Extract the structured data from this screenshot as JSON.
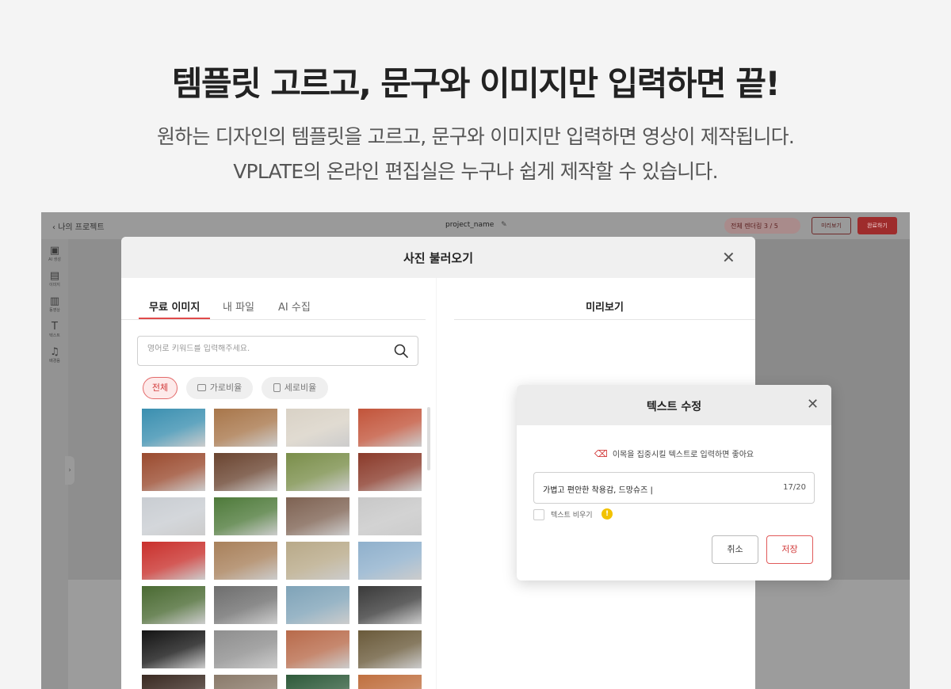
{
  "hero": {
    "title": "템플릿 고르고, 문구와 이미지만 입력하면 끝!",
    "subtitle_line1": "원하는 디자인의 템플릿을 고르고, 문구와 이미지만 입력하면 영상이 제작됩니다.",
    "subtitle_line2": "VPLATE의 온라인 편집실은 누구나 쉽게 제작할 수 있습니다."
  },
  "editor": {
    "back_label": "나의 프로젝트",
    "project_name": "project_name",
    "render_status": "전체 렌더링 3 / 5",
    "preview_button": "미리보기",
    "done_button": "완료하기",
    "rail": [
      "AI 생성",
      "이미지",
      "동영상",
      "텍스트",
      "배경음"
    ]
  },
  "photo_modal": {
    "title": "사진 불러오기",
    "tabs": [
      "무료 이미지",
      "내 파일",
      "AI 수집"
    ],
    "search_placeholder": "영어로 키워드를 입력해주세요.",
    "filters": [
      "전체",
      "가로비율",
      "세로비율"
    ],
    "preview_title": "미리보기",
    "thumbnail_colors": [
      [
        "#3a8fb0",
        "#a8764a",
        "#d9d2c6",
        "#c2543a"
      ],
      [
        "#9a4a2e",
        "#6a4430",
        "#7a8e4a",
        "#8a3a2a"
      ],
      [
        "#c9cdd2",
        "#4e7a3a",
        "#7e6252",
        "#c8c8c8"
      ],
      [
        "#c9302c",
        "#a8805a",
        "#b8a988",
        "#8fb0cc"
      ],
      [
        "#4a6a32",
        "#6e6e6e",
        "#7fa3b8",
        "#3a3a3a"
      ],
      [
        "#141414",
        "#8e8e8e",
        "#b86a4a",
        "#6a5a3a"
      ],
      [
        "#3a2a22",
        "#8a7a6a",
        "#2e5a3a",
        "#c07040"
      ]
    ]
  },
  "text_dialog": {
    "title": "텍스트 수정",
    "hint": "이목을 집중시킬 텍스트로 입력하면 좋아요",
    "value": "가볍고 편안한 착용감, 드망슈즈 |",
    "count": "17/20",
    "clear_label": "텍스트 비우기",
    "cancel": "취소",
    "save": "저장"
  }
}
